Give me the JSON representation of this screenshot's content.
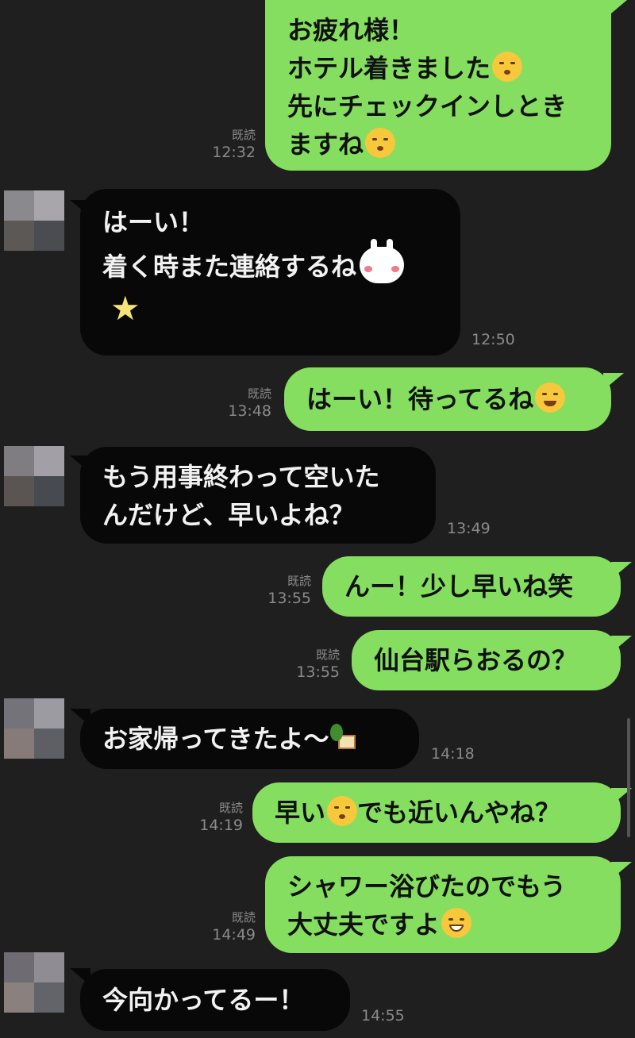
{
  "chat": {
    "read_label": "既読",
    "messages": [
      {
        "id": "m1",
        "side": "me",
        "lines": [
          "お疲れ様！",
          "ホテル着きました",
          "先にチェックインしとき",
          "ますね"
        ],
        "time": "12:32",
        "read": true
      },
      {
        "id": "m2",
        "side": "them",
        "lines": [
          "はーい！",
          "着く時また連絡するね"
        ],
        "time": "12:50"
      },
      {
        "id": "m3",
        "side": "me",
        "lines": [
          "はーい！待ってるね"
        ],
        "time": "13:48",
        "read": true
      },
      {
        "id": "m4",
        "side": "them",
        "lines": [
          "もう用事終わって空いた",
          "んだけど、早いよね？"
        ],
        "time": "13:49"
      },
      {
        "id": "m5",
        "side": "me",
        "lines": [
          "んー！少し早いね笑"
        ],
        "time": "13:55",
        "read": true
      },
      {
        "id": "m6",
        "side": "me",
        "lines": [
          "仙台駅らおるの？"
        ],
        "time": "13:55",
        "read": true
      },
      {
        "id": "m7",
        "side": "them",
        "lines": [
          "お家帰ってきたよ〜"
        ],
        "time": "14:18"
      },
      {
        "id": "m8",
        "side": "me",
        "lines": [
          "早い",
          "でも近いんやね？"
        ],
        "time": "14:19",
        "read": true
      },
      {
        "id": "m9",
        "side": "me",
        "lines": [
          "シャワー浴びたのでもう",
          "大丈夫ですよ"
        ],
        "time": "14:49",
        "read": true
      },
      {
        "id": "m10",
        "side": "them",
        "lines": [
          "今向かってるー！"
        ],
        "time": "14:55"
      }
    ]
  },
  "colors": {
    "background": "#1f1f1f",
    "my_bubble": "#85de5f",
    "their_bubble": "#080808"
  },
  "icons": [
    "kissing-face-icon",
    "rabbit-sticker-icon",
    "star-icon",
    "yum-face-icon",
    "house-with-tree-icon",
    "grinning-face-icon"
  ]
}
